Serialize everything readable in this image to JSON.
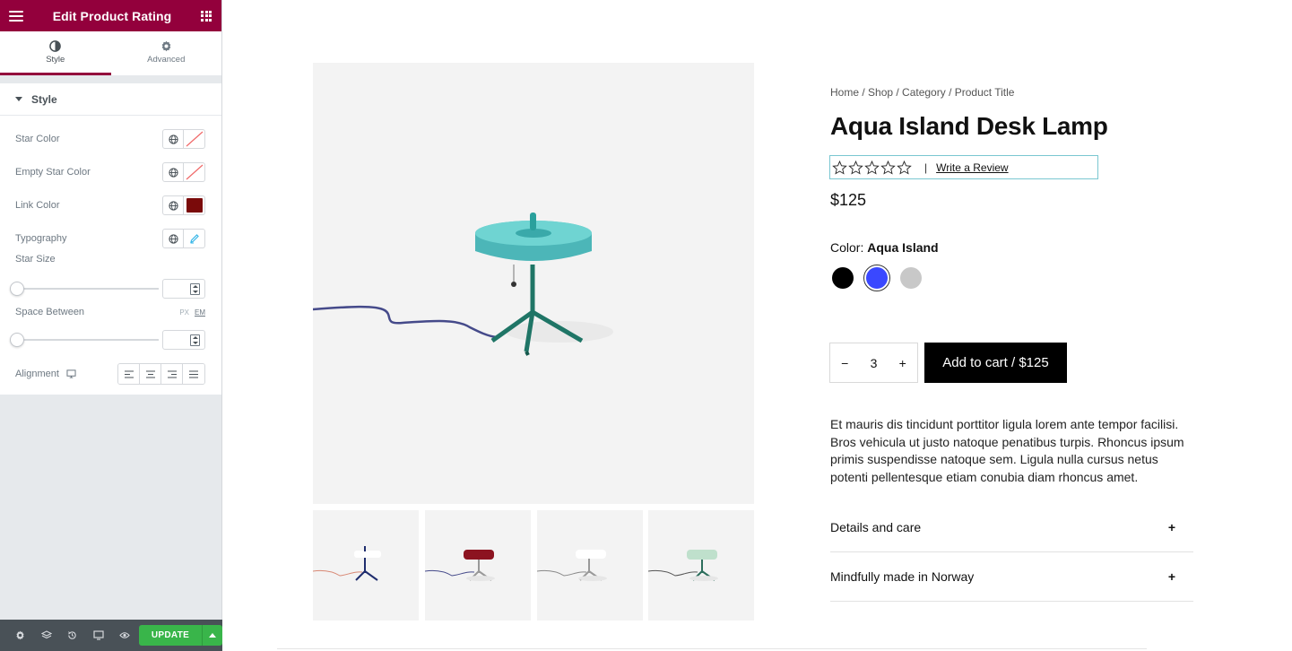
{
  "sidebar": {
    "title": "Edit Product Rating",
    "tabs": [
      {
        "label": "Style",
        "icon": "contrast-icon"
      },
      {
        "label": "Advanced",
        "icon": "gear-icon"
      }
    ],
    "section_title": "Style",
    "controls": {
      "star_color": "Star Color",
      "empty_star_color": "Empty Star Color",
      "link_color": "Link Color",
      "link_color_value": "#7a0a0a",
      "typography": "Typography",
      "star_size": "Star Size",
      "space_between": "Space Between",
      "units": [
        "PX",
        "EM"
      ],
      "alignment": "Alignment"
    },
    "footer": {
      "update_label": "UPDATE"
    }
  },
  "product": {
    "breadcrumb": "Home / Shop / Category / Product Title",
    "title": "Aqua Island Desk Lamp",
    "rating_separator": "|",
    "review_link": "Write a Review",
    "price": "$125",
    "color_label": "Color:",
    "color_value": "Aqua Island",
    "swatches": [
      "#000000",
      "#3a48ff",
      "#c8c8c8"
    ],
    "quantity": "3",
    "minus": "−",
    "plus": "+",
    "add_to_cart": "Add to cart / $125",
    "description": "Et mauris dis tincidunt porttitor ligula lorem ante tempor facilisi. Bros vehicula ut justo natoque penatibus turpis. Rhoncus ipsum primis suspendisse natoque sem. Ligula nulla cursus netus potenti pellentesque etiam conubia diam rhoncus amet.",
    "accordions": [
      {
        "title": "Details and care",
        "icon": "+"
      },
      {
        "title": "Mindfully made in Norway",
        "icon": "+"
      }
    ]
  }
}
